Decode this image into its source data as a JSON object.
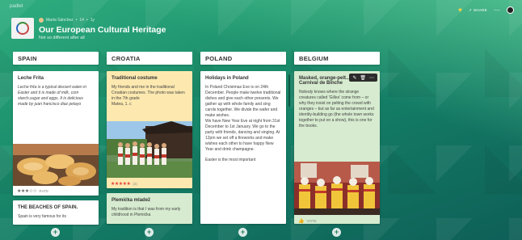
{
  "app": {
    "brand": "padlet"
  },
  "board": {
    "author": "Marta Sánchez",
    "likes": "14",
    "time": "1y",
    "title": "Our European Cultural Heritage",
    "subtitle": "Not so different after all",
    "share_label": "SHARE"
  },
  "columns": [
    {
      "name": "SPAIN"
    },
    {
      "name": "CROATIA"
    },
    {
      "name": "POLAND"
    },
    {
      "name": "BELGIUM"
    }
  ],
  "posts": {
    "spain_1": {
      "title": "Leche Frita",
      "body": "Leche frita is a typical dessert eaten in Easter and it is made of milk, corn starch,sugar and eggs. It is delicious",
      "credit": "made by juan francisco diaz pelayo",
      "rating_count": "RATE",
      "rating": 3
    },
    "spain_2": {
      "title": "THE BEACHES OF SPAIN.",
      "body": "Spain is very famous for its"
    },
    "croatia_1": {
      "title": "Traditional costume",
      "body": "My friends and me in the traditional Croatian costumes. The photo was taken in the 7th grade",
      "credit": "Matea, 1. c",
      "rating_count": "(2)",
      "rating": 5
    },
    "croatia_2": {
      "title": "Plemićka mladež",
      "body": "My tradition is that I was from my early childhood in Plemićka"
    },
    "poland_1": {
      "title": "Holidays in Poland",
      "body1": "In Poland Christmas Eve is on 24th December. People make twelve traditional dishes and give each other presents. We gather up with whole family and sing carols together. We divide the wafer and make wishes.",
      "body2": "We have New Year Eve at night from 31st December to 1st January. We go to the party with friends, dancing and singing. At 12pm we set off a fireworks and make wishes each other to have happy New Year and drink champagne.",
      "body3": "Easter is the most important"
    },
    "belgium_1": {
      "title": "Masked, orange-pelt... at Carnival de Binche",
      "body": "Nobody knows where the strange creatures called 'Gilles' come from – or why they insist on pelting the crowd with oranges – but as far as entertainment and identity-building go (the whole town works together to put on a show), this is one for the books.",
      "rating_count": "VOTE"
    }
  },
  "colors": {
    "yellow_post": "#fde9b0",
    "green_post": "#d6ebcf",
    "accent": "#1c8f6c"
  }
}
